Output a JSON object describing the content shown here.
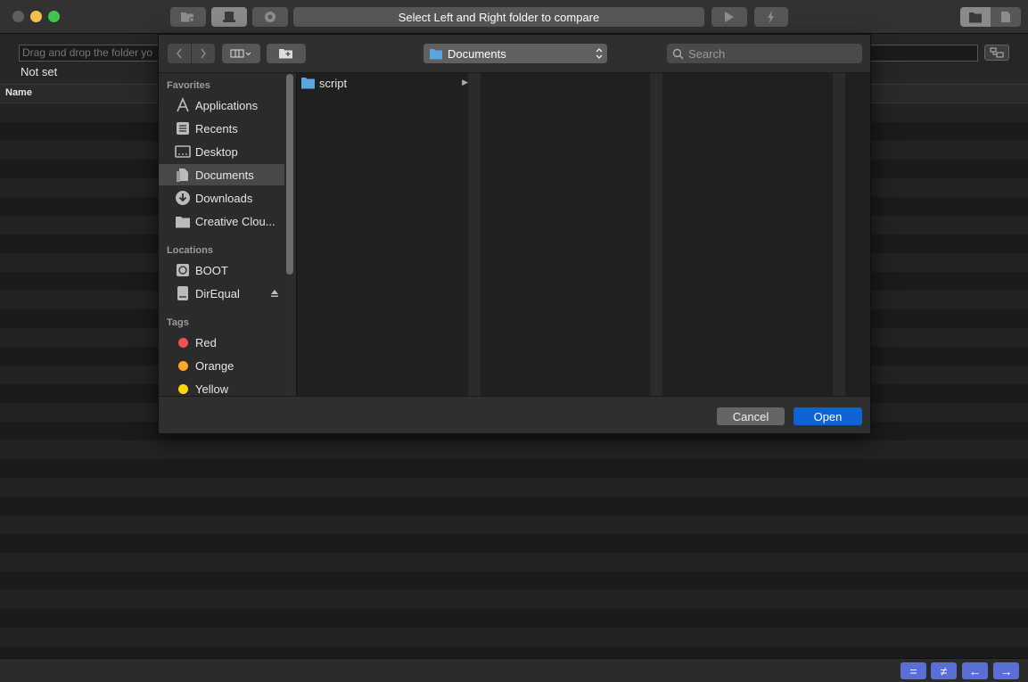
{
  "toolbar": {
    "status_text": "Select Left and Right folder to compare"
  },
  "left_panel": {
    "drop_placeholder": "Drag and drop the folder yo",
    "path_label": "Not set",
    "column_header": "Name"
  },
  "dialog": {
    "location": "Documents",
    "search_placeholder": "Search",
    "sidebar": {
      "favorites_heading": "Favorites",
      "favorites": [
        {
          "label": "Applications",
          "icon": "applications-icon"
        },
        {
          "label": "Recents",
          "icon": "recents-icon"
        },
        {
          "label": "Desktop",
          "icon": "desktop-icon"
        },
        {
          "label": "Documents",
          "icon": "documents-icon",
          "selected": true
        },
        {
          "label": "Downloads",
          "icon": "downloads-icon"
        },
        {
          "label": "Creative Clou...",
          "icon": "folder-icon"
        }
      ],
      "locations_heading": "Locations",
      "locations": [
        {
          "label": "BOOT",
          "icon": "disk-icon"
        },
        {
          "label": "DirEqual",
          "icon": "drive-icon"
        }
      ],
      "tags_heading": "Tags",
      "tags": [
        {
          "label": "Red",
          "color": "#ef5350"
        },
        {
          "label": "Orange",
          "color": "#ffa726"
        },
        {
          "label": "Yellow",
          "color": "#ffd600"
        }
      ]
    },
    "files": [
      {
        "name": "script"
      }
    ],
    "cancel_label": "Cancel",
    "open_label": "Open"
  },
  "bottom_buttons": {
    "equal": "=",
    "not_equal": "≠",
    "left_arrow": "←",
    "right_arrow": "→"
  },
  "colors": {
    "accent": "#0f63d6",
    "bottom_button": "#5a6fd6"
  }
}
